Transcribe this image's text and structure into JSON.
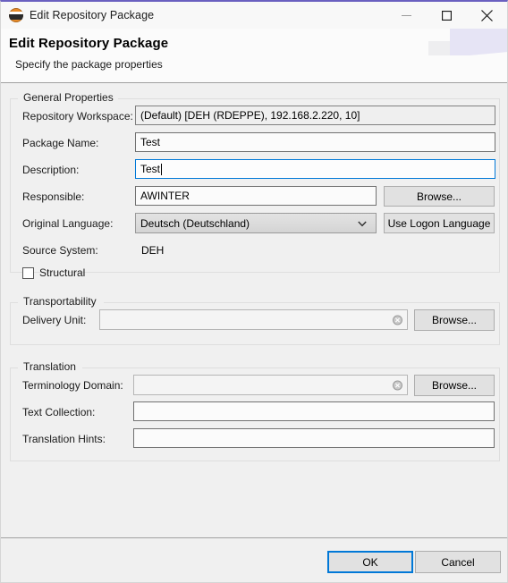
{
  "window": {
    "title": "Edit Repository Package",
    "icon": "hana-package-icon",
    "accent_color": "#6a60c0",
    "controls": {
      "minimize": "minimize-icon",
      "maximize": "maximize-icon",
      "close": "close-icon"
    }
  },
  "header": {
    "title": "Edit Repository Package",
    "subtitle": "Specify the package properties"
  },
  "general": {
    "legend": "General Properties",
    "repository_workspace": {
      "label": "Repository Workspace:",
      "value": "(Default) [DEH (RDEPPE), 192.168.2.220,  10]",
      "readonly": true
    },
    "package_name": {
      "label": "Package Name:",
      "value": "Test",
      "placeholder": ""
    },
    "description": {
      "label": "Description:",
      "value": "Test",
      "placeholder": "",
      "focused": true
    },
    "responsible": {
      "label": "Responsible:",
      "value": "AWINTER",
      "placeholder": "",
      "browse_label": "Browse..."
    },
    "original_language": {
      "label": "Original Language:",
      "value": "Deutsch (Deutschland)",
      "use_logon_label": "Use Logon Language",
      "arrow_icon": "chevron-down-icon"
    },
    "source_system": {
      "label": "Source System:",
      "value": "DEH"
    },
    "structural": {
      "label": "Structural",
      "checked": false
    }
  },
  "transportability": {
    "legend": "Transportability",
    "delivery_unit": {
      "label": "Delivery Unit:",
      "value": "",
      "placeholder": "",
      "clear_icon": "clear-field-icon",
      "browse_label": "Browse..."
    }
  },
  "translation": {
    "legend": "Translation",
    "terminology_domain": {
      "label": "Terminology Domain:",
      "value": "",
      "placeholder": "",
      "clear_icon": "clear-field-icon",
      "browse_label": "Browse..."
    },
    "text_collection": {
      "label": "Text Collection:",
      "value": "",
      "placeholder": ""
    },
    "translation_hints": {
      "label": "Translation Hints:",
      "value": "",
      "placeholder": ""
    }
  },
  "footer": {
    "ok_label": "OK",
    "cancel_label": "Cancel",
    "focus_color": "#0078d7"
  }
}
